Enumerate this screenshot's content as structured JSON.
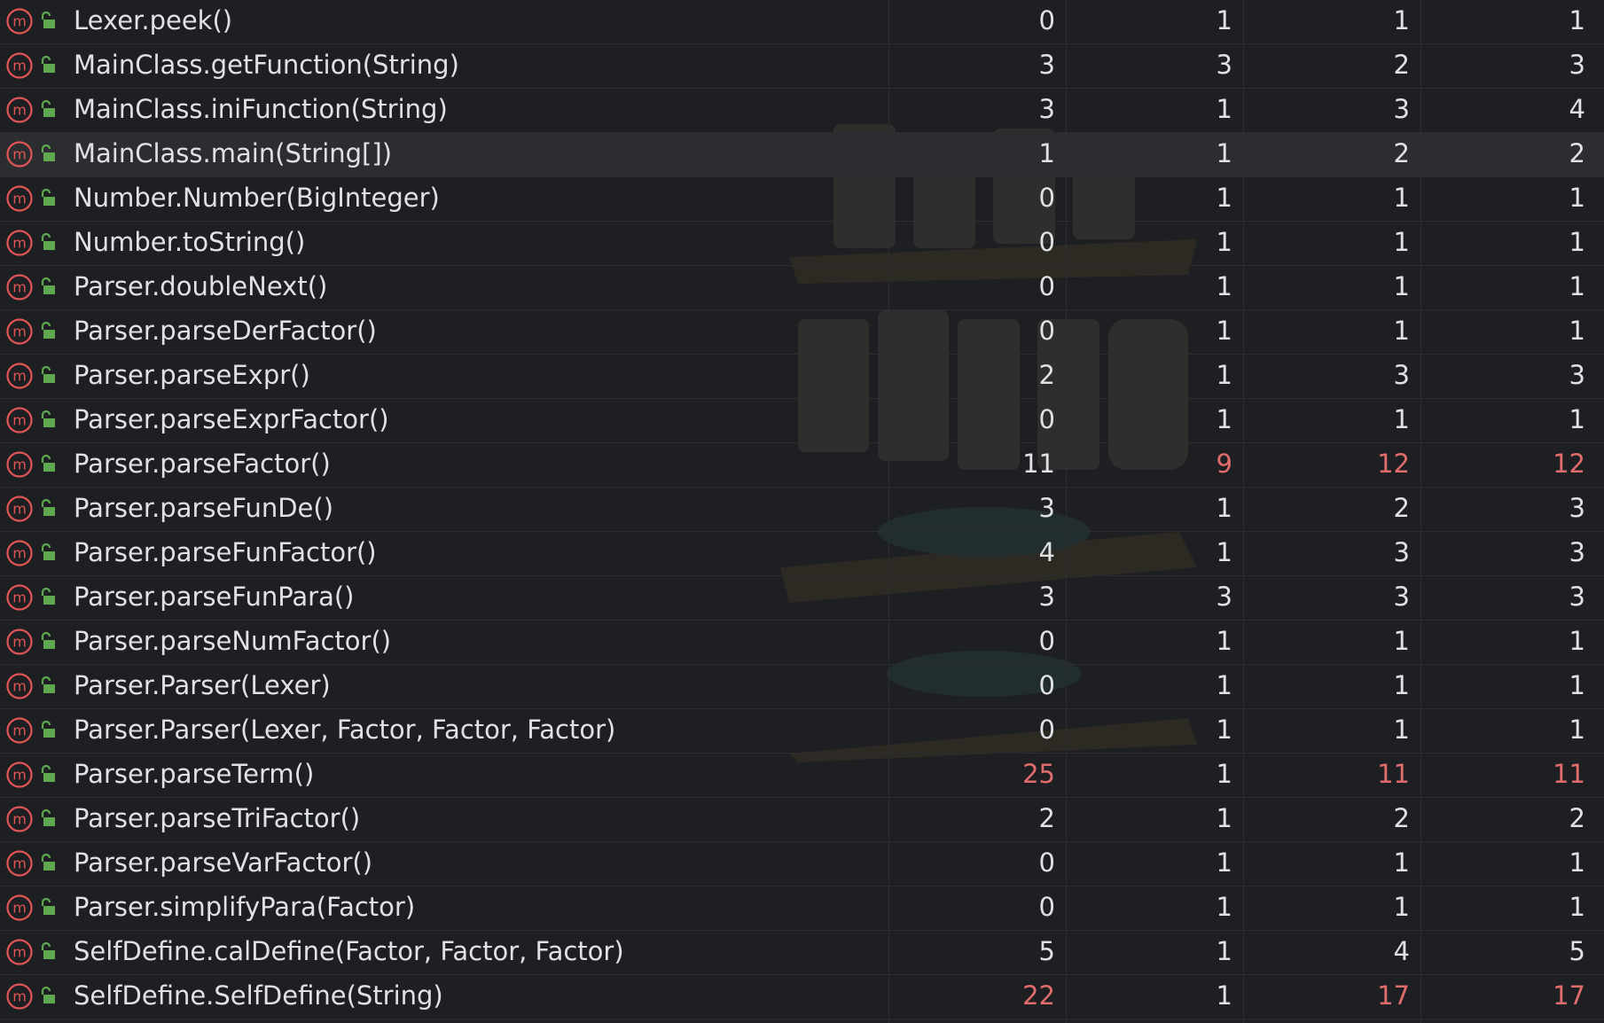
{
  "colors": {
    "background": "#1e1f22",
    "row_selected": "#2b2d30",
    "text": "#dfe1e5",
    "threshold_exceeded": "#e06c6c",
    "method_icon": "#e05555",
    "lock_icon": "#5fa84f"
  },
  "icons": {
    "method": "method-m-icon",
    "visibility": "public-lock-icon"
  },
  "rows": [
    {
      "name": "Lexer.peek()",
      "v": [
        "0",
        "1",
        "1",
        "1"
      ],
      "red": [
        false,
        false,
        false,
        false
      ]
    },
    {
      "name": "MainClass.getFunction(String)",
      "v": [
        "3",
        "3",
        "2",
        "3"
      ],
      "red": [
        false,
        false,
        false,
        false
      ]
    },
    {
      "name": "MainClass.iniFunction(String)",
      "v": [
        "3",
        "1",
        "3",
        "4"
      ],
      "red": [
        false,
        false,
        false,
        false
      ]
    },
    {
      "name": "MainClass.main(String[])",
      "v": [
        "1",
        "1",
        "2",
        "2"
      ],
      "red": [
        false,
        false,
        false,
        false
      ],
      "selected": true
    },
    {
      "name": "Number.Number(BigInteger)",
      "v": [
        "0",
        "1",
        "1",
        "1"
      ],
      "red": [
        false,
        false,
        false,
        false
      ]
    },
    {
      "name": "Number.toString()",
      "v": [
        "0",
        "1",
        "1",
        "1"
      ],
      "red": [
        false,
        false,
        false,
        false
      ]
    },
    {
      "name": "Parser.doubleNext()",
      "v": [
        "0",
        "1",
        "1",
        "1"
      ],
      "red": [
        false,
        false,
        false,
        false
      ]
    },
    {
      "name": "Parser.parseDerFactor()",
      "v": [
        "0",
        "1",
        "1",
        "1"
      ],
      "red": [
        false,
        false,
        false,
        false
      ]
    },
    {
      "name": "Parser.parseExpr()",
      "v": [
        "2",
        "1",
        "3",
        "3"
      ],
      "red": [
        false,
        false,
        false,
        false
      ]
    },
    {
      "name": "Parser.parseExprFactor()",
      "v": [
        "0",
        "1",
        "1",
        "1"
      ],
      "red": [
        false,
        false,
        false,
        false
      ]
    },
    {
      "name": "Parser.parseFactor()",
      "v": [
        "11",
        "9",
        "12",
        "12"
      ],
      "red": [
        false,
        true,
        true,
        true
      ]
    },
    {
      "name": "Parser.parseFunDe()",
      "v": [
        "3",
        "1",
        "2",
        "3"
      ],
      "red": [
        false,
        false,
        false,
        false
      ]
    },
    {
      "name": "Parser.parseFunFactor()",
      "v": [
        "4",
        "1",
        "3",
        "3"
      ],
      "red": [
        false,
        false,
        false,
        false
      ]
    },
    {
      "name": "Parser.parseFunPara()",
      "v": [
        "3",
        "3",
        "3",
        "3"
      ],
      "red": [
        false,
        false,
        false,
        false
      ]
    },
    {
      "name": "Parser.parseNumFactor()",
      "v": [
        "0",
        "1",
        "1",
        "1"
      ],
      "red": [
        false,
        false,
        false,
        false
      ]
    },
    {
      "name": "Parser.Parser(Lexer)",
      "v": [
        "0",
        "1",
        "1",
        "1"
      ],
      "red": [
        false,
        false,
        false,
        false
      ]
    },
    {
      "name": "Parser.Parser(Lexer, Factor, Factor, Factor)",
      "v": [
        "0",
        "1",
        "1",
        "1"
      ],
      "red": [
        false,
        false,
        false,
        false
      ]
    },
    {
      "name": "Parser.parseTerm()",
      "v": [
        "25",
        "1",
        "11",
        "11"
      ],
      "red": [
        true,
        false,
        true,
        true
      ]
    },
    {
      "name": "Parser.parseTriFactor()",
      "v": [
        "2",
        "1",
        "2",
        "2"
      ],
      "red": [
        false,
        false,
        false,
        false
      ]
    },
    {
      "name": "Parser.parseVarFactor()",
      "v": [
        "0",
        "1",
        "1",
        "1"
      ],
      "red": [
        false,
        false,
        false,
        false
      ]
    },
    {
      "name": "Parser.simplifyPara(Factor)",
      "v": [
        "0",
        "1",
        "1",
        "1"
      ],
      "red": [
        false,
        false,
        false,
        false
      ]
    },
    {
      "name": "SelfDefine.calDefine(Factor, Factor, Factor)",
      "v": [
        "5",
        "1",
        "4",
        "5"
      ],
      "red": [
        false,
        false,
        false,
        false
      ]
    },
    {
      "name": "SelfDefine.SelfDefine(String)",
      "v": [
        "22",
        "1",
        "17",
        "17"
      ],
      "red": [
        true,
        false,
        true,
        true
      ]
    }
  ]
}
